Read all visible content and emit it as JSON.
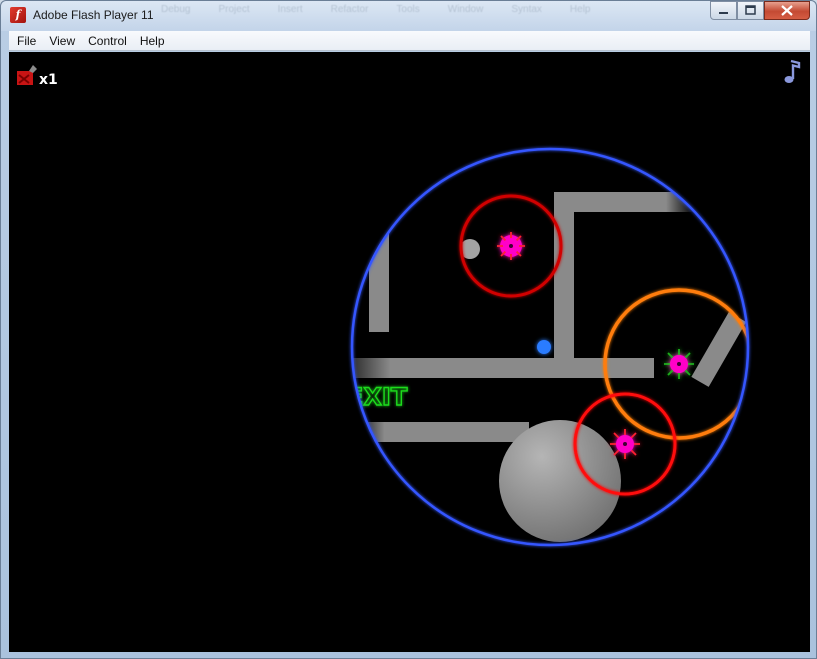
{
  "window": {
    "title": "Adobe Flash Player 11",
    "background_menu_ghost": [
      "Debug",
      "Project",
      "Insert",
      "Refactor",
      "Tools",
      "Window",
      "Syntax",
      "Help"
    ],
    "controls": {
      "minimize": "▭",
      "maximize": "□",
      "close": "✕"
    }
  },
  "menubar": {
    "items": [
      "File",
      "View",
      "Control",
      "Help"
    ]
  },
  "game": {
    "lives_count": "x1",
    "exit_label": "EXIT",
    "colors": {
      "background": "#000000",
      "wall": "#8c8c8c",
      "vision_ring": "#3b5bff",
      "turret_ring_red": "#e00000",
      "turret_ring_orange": "#ff8a1a",
      "turret_core": "#ff00c8",
      "player": "#1a6bff",
      "exit_text": "#1fdc1f",
      "music_icon": "#7f8fd6"
    },
    "icons": {
      "lives": "bomb-icon",
      "music": "music-note-icon"
    }
  }
}
